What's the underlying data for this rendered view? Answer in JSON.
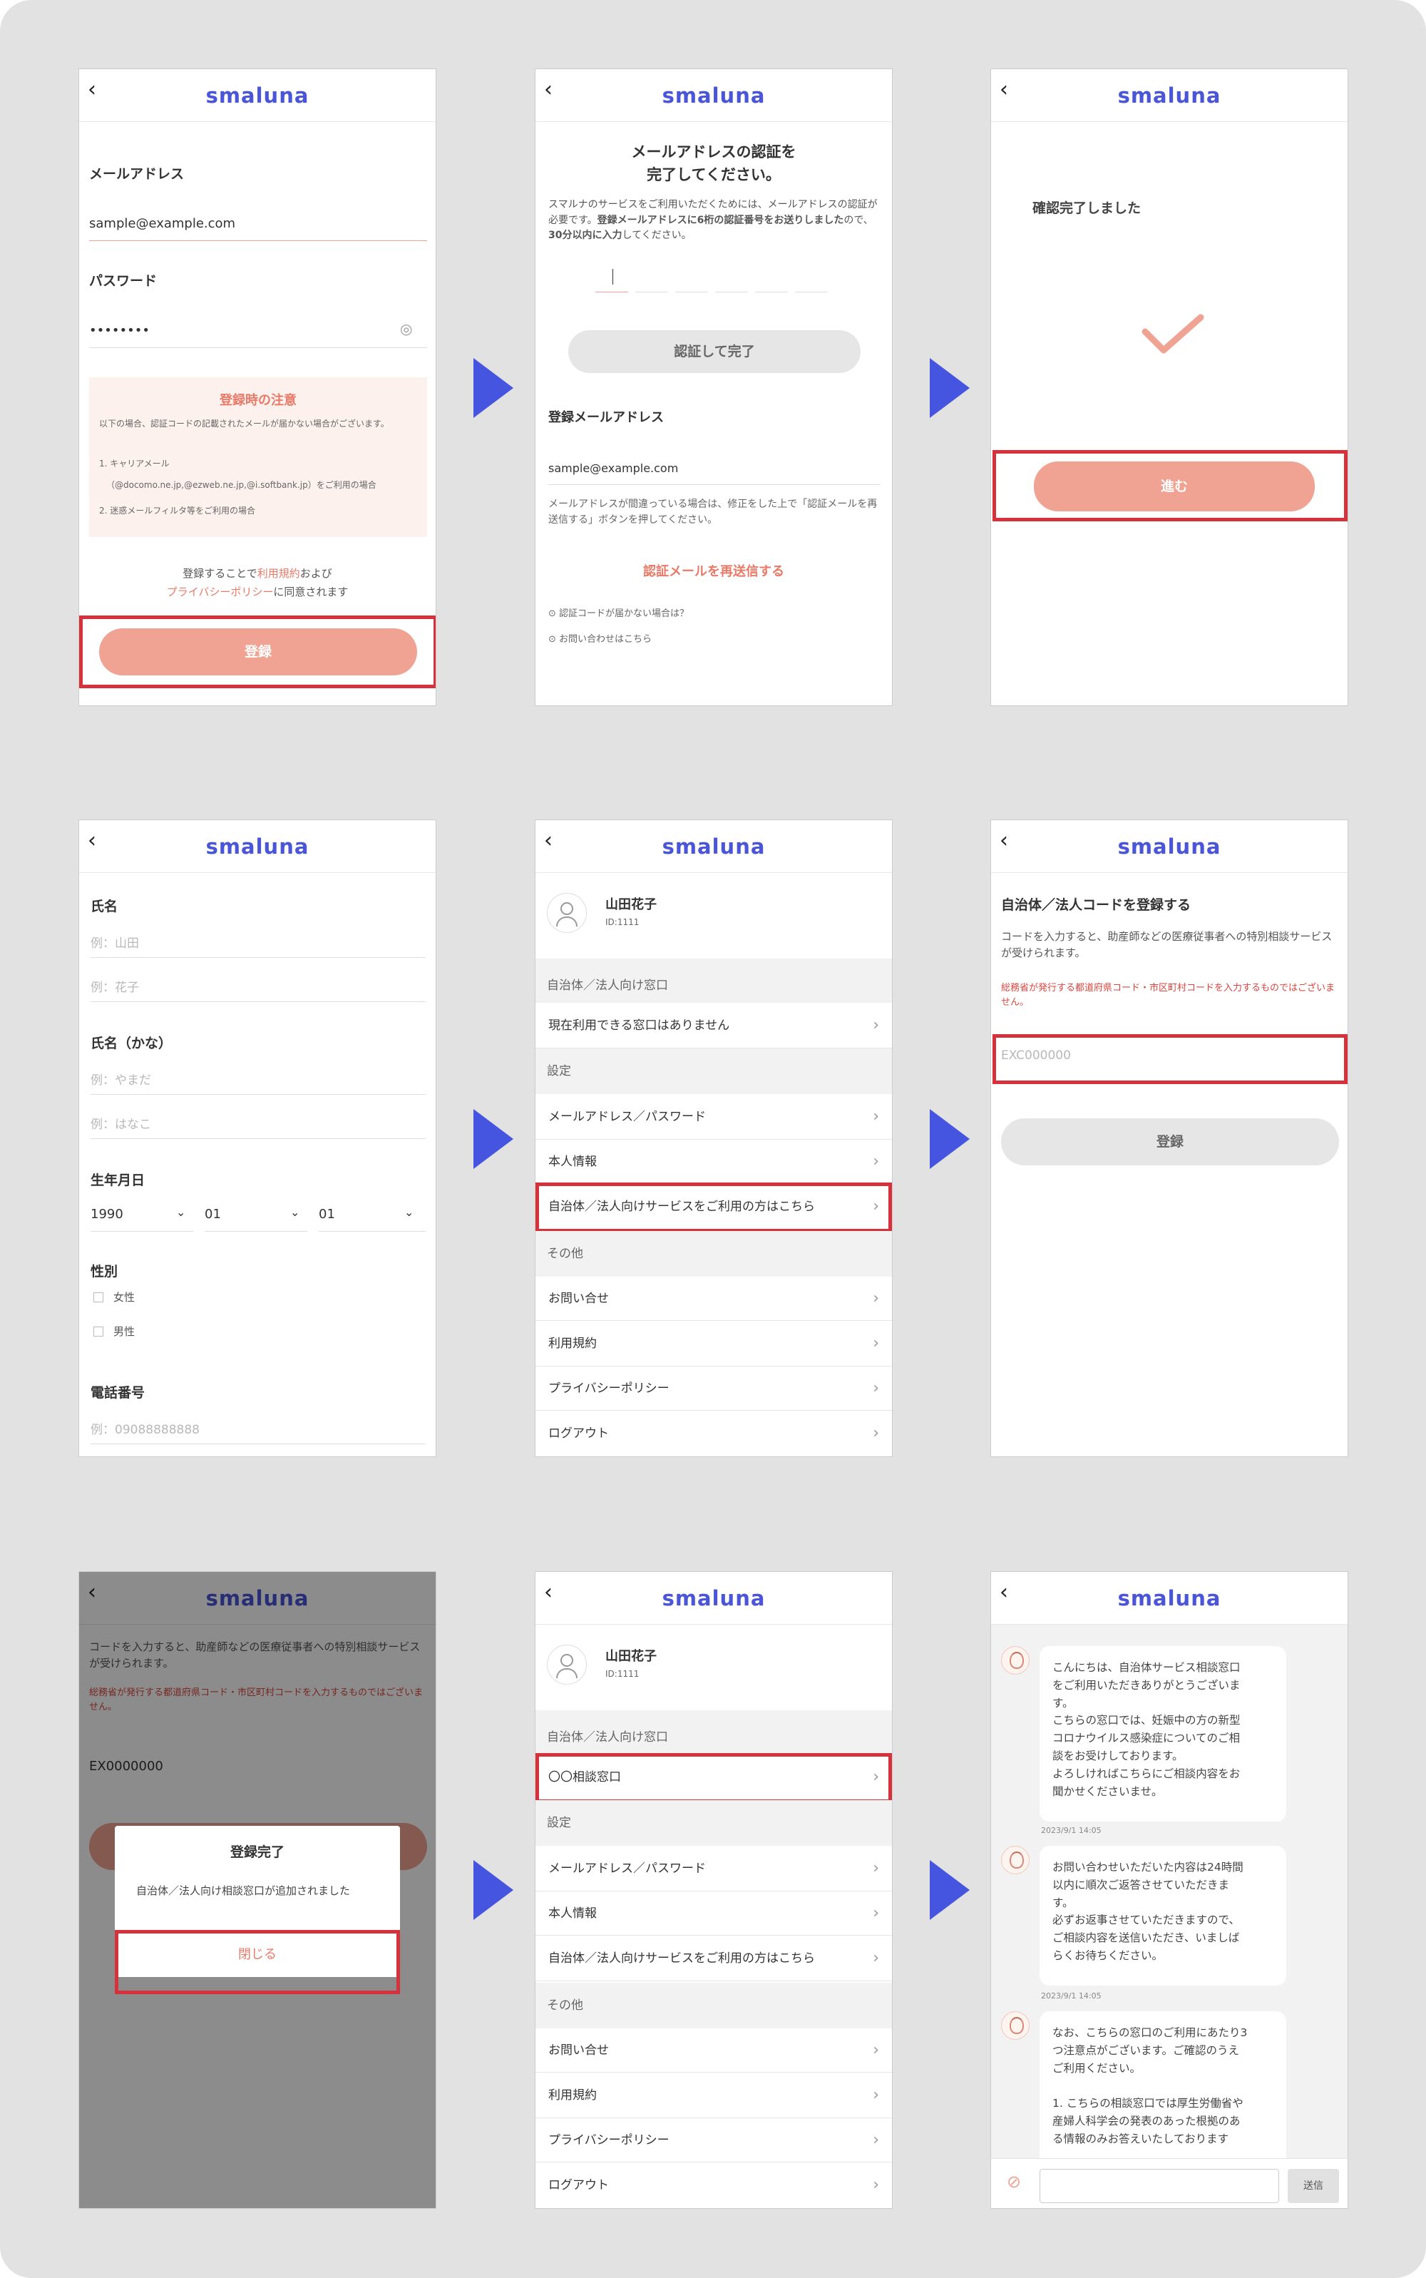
{
  "common": {
    "logo": "smaluna",
    "back_icon": "chevron-left-icon",
    "flow_arrow_color": "#4655e0",
    "highlight_color": "#d7323c",
    "accent_color": "#f0a392"
  },
  "s1": {
    "email_label": "メールアドレス",
    "email_value": "sample@example.com",
    "password_label": "パスワード",
    "password_value": "••••••••",
    "notice_title": "登録時の注意",
    "notice_text1": "以下の場合、認証コードの記載されたメールが届かない場合がございます。",
    "notice_item1": "1. キャリアメール",
    "notice_item1b": "（@docomo.ne.jp,@ezweb.ne.jp,@i.softbank.jp）をご利用の場合",
    "notice_item2": "2. 迷惑メールフィルタ等をご利用の場合",
    "agree_pre": "登録することで",
    "terms_link": "利用規約",
    "agree_and": "および",
    "privacy_link": "プライバシーポリシー",
    "agree_post": "に同意されます",
    "register_button": "登録"
  },
  "s2": {
    "title_line1": "メールアドレスの認証を",
    "title_line2": "完了してください。",
    "desc_pre": "スマルナのサービスをご利用いただくためには、メールアドレスの認証が必要です。",
    "desc_bold1": "登録メールアドレスに6桁の認証番号をお送りしました",
    "desc_mid": "ので、",
    "desc_bold2": "30分以内に入力",
    "desc_post": "してください。",
    "verify_button": "認証して完了",
    "reg_email_label": "登録メールアドレス",
    "reg_email_value": "sample@example.com",
    "fix_note": "メールアドレスが間違っている場合は、修正をした上で「認証メールを再送信する」ボタンを押してください。",
    "resend_link": "認証メールを再送信する",
    "help1": "認証コードが届かない場合は？",
    "help2": "お問い合わせはこちら"
  },
  "s3": {
    "done_text": "確認完了しました",
    "next_button": "進む"
  },
  "s4": {
    "name_label": "氏名",
    "last_ph": "例：山田",
    "first_ph": "例：花子",
    "kana_label": "氏名（かな）",
    "kana_last_ph": "例：やまだ",
    "kana_first_ph": "例：はなこ",
    "dob_label": "生年月日",
    "year": "1990",
    "month": "01",
    "day": "01",
    "gender_label": "性別",
    "female": "女性",
    "male": "男性",
    "phone_label": "電話番号",
    "phone_ph": "例：09088888888"
  },
  "s5": {
    "user_name": "山田花子",
    "user_id": "ID:1111",
    "sec_corp": "自治体／法人向け窓口",
    "no_window": "現在利用できる窓口はありません",
    "sec_settings": "設定",
    "item_mail": "メールアドレス／パスワード",
    "item_profile": "本人情報",
    "item_corp": "自治体／法人向けサービスをご利用の方はこちら",
    "sec_other": "その他",
    "item_contact": "お問い合せ",
    "item_terms": "利用規約",
    "item_privacy": "プライバシーポリシー",
    "item_logout": "ログアウト"
  },
  "s6": {
    "title": "自治体／法人コードを登録する",
    "desc": "コードを入力すると、助産師などの医療従事者への特別相談サービスが受けられます。",
    "warn": "総務省が発行する都道府県コード・市区町村コードを入力するものではございません。",
    "code_ph": "EXC000000",
    "register_button": "登録"
  },
  "s7": {
    "desc": "コードを入力すると、助産師などの医療従事者への特別相談サービスが受けられます。",
    "warn": "総務省が発行する都道府県コード・市区町村コードを入力するものではございません。",
    "code_value": "EX0000000",
    "modal_title": "登録完了",
    "modal_text": "自治体／法人向け相談窓口が追加されました",
    "close_button": "閉じる"
  },
  "s8": {
    "user_name": "山田花子",
    "user_id": "ID:1111",
    "sec_corp": "自治体／法人向け窓口",
    "window_item": "〇〇相談窓口",
    "sec_settings": "設定",
    "item_mail": "メールアドレス／パスワード",
    "item_profile": "本人情報",
    "item_corp": "自治体／法人向けサービスをご利用の方はこちら",
    "sec_other": "その他",
    "item_contact": "お問い合せ",
    "item_terms": "利用規約",
    "item_privacy": "プライバシーポリシー",
    "item_logout": "ログアウト"
  },
  "s9": {
    "msg1": "こんにちは、自治体サービス相談窓口\nをご利用いただきありがとうございま\nす。\nこちらの窓口では、妊娠中の方の新型\nコロナウイルス感染症についてのご相\n談をお受けしております。\nよろしければこちらにご相談内容をお\n聞かせくださいませ。",
    "time1": "2023/9/1 14:05",
    "msg2": "お問い合わせいただいた内容は24時間\n以内に順次ご返答させていただきま\nす。\n必ずお返事させていただきますので、\nご相談内容を送信いただき、いましば\nらくお待ちください。",
    "time2": "2023/9/1 14:05",
    "msg3": "なお、こちらの窓口のご利用にあたり3\nつ注意点がございます。ご確認のうえ\nご利用ください。\n\n1. こちらの相談窓口では厚生労働省や\n産婦人科学会の発表のあった根拠のあ\nる情報のみお答えいたしております",
    "send_button": "送信",
    "attach_icon": "paperclip-icon"
  }
}
